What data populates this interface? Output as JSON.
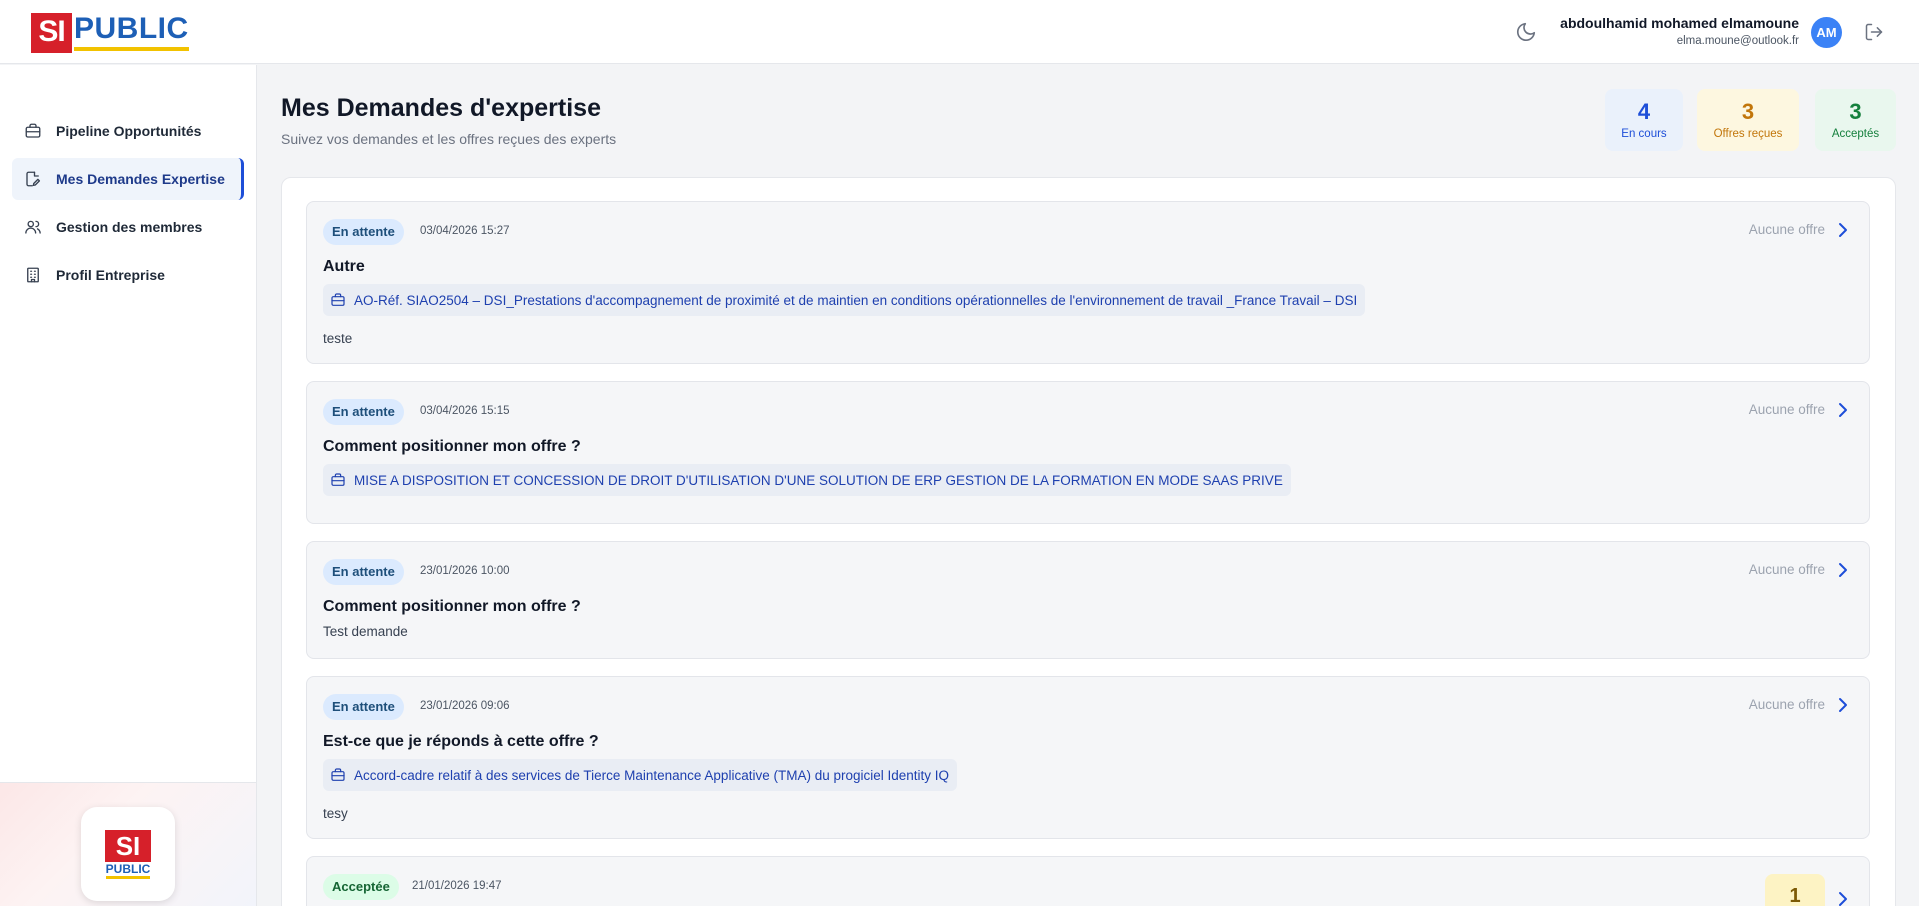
{
  "brand": {
    "logo_si": "SI",
    "logo_public": "PUBLIC"
  },
  "user": {
    "name": "abdoulhamid mohamed elmamoune",
    "email": "elma.moune@outlook.fr",
    "initials": "AM"
  },
  "sidebar": {
    "items": [
      {
        "label": "Pipeline Opportunités",
        "icon": "briefcase-icon"
      },
      {
        "label": "Mes Demandes Expertise",
        "icon": "edit-document-icon",
        "active": true
      },
      {
        "label": "Gestion des membres",
        "icon": "users-icon"
      },
      {
        "label": "Profil Entreprise",
        "icon": "building-icon"
      }
    ],
    "footer_logo": {
      "si": "SI",
      "public": "PUBLIC"
    }
  },
  "page": {
    "title": "Mes Demandes d'expertise",
    "subtitle": "Suivez vos demandes et les offres reçues des experts"
  },
  "stats": [
    {
      "value": "4",
      "label": "En cours",
      "color": "#1d4ed8"
    },
    {
      "value": "3",
      "label": "Offres reçues",
      "color": "#c2760a"
    },
    {
      "value": "3",
      "label": "Acceptés",
      "color": "#15803d"
    }
  ],
  "requests": [
    {
      "status": "En attente",
      "date": "03/04/2026 15:27",
      "title": "Autre",
      "reference": "AO-Réf. SIAO2504 – DSI_Prestations d'accompagnement de proximité et de maintien en conditions opérationnelles de l'environnement de travail _France Travail – DSI",
      "description": "teste",
      "offers": "Aucune offre"
    },
    {
      "status": "En attente",
      "date": "03/04/2026 15:15",
      "title": "Comment positionner mon offre ?",
      "reference": "MISE A DISPOSITION ET CONCESSION DE DROIT D'UTILISATION D'UNE SOLUTION DE ERP GESTION DE LA FORMATION EN MODE SAAS PRIVE",
      "offers": "Aucune offre"
    },
    {
      "status": "En attente",
      "date": "23/01/2026 10:00",
      "title": "Comment positionner mon offre ?",
      "description": "Test demande",
      "offers": "Aucune offre"
    },
    {
      "status": "En attente",
      "date": "23/01/2026 09:06",
      "title": "Est-ce que je réponds à cette offre ?",
      "reference": "Accord-cadre relatif à des services de Tierce Maintenance Applicative (TMA) du progiciel Identity IQ",
      "description": "tesy",
      "offers": "Aucune offre"
    },
    {
      "status": "Acceptée",
      "date": "21/01/2026 19:47",
      "offer_count": "1"
    }
  ]
}
